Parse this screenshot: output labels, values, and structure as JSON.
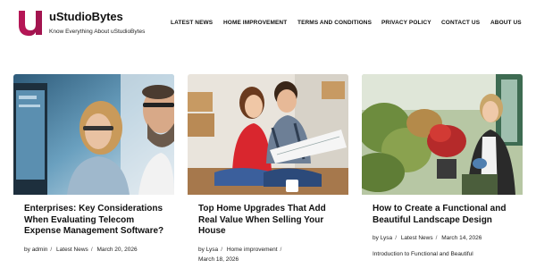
{
  "site": {
    "name": "uStudioBytes",
    "tagline": "Know Everything About uStudioBytes",
    "logo_icon": "u-letter-logo",
    "brand_color": "#a3144f"
  },
  "nav": {
    "items": [
      {
        "label": "LATEST NEWS"
      },
      {
        "label": "HOME IMPROVEMENT"
      },
      {
        "label": "TERMS AND CONDITIONS"
      },
      {
        "label": "PRIVACY POLICY"
      },
      {
        "label": "CONTACT US"
      },
      {
        "label": "ABOUT US"
      }
    ]
  },
  "posts": [
    {
      "title": "Enterprises: Key Considerations When Evaluating Telecom Expense Management Software?",
      "author_prefix": "by",
      "author": "admin",
      "category": "Latest News",
      "date": "March 20, 2026",
      "image": "office-team-monitor-photo"
    },
    {
      "title": "Top Home Upgrades That Add Real Value When Selling Your House",
      "author_prefix": "by",
      "author": "Lysa",
      "category": "Home improvement",
      "date": "March 18, 2026",
      "image": "couple-reviewing-plans-photo"
    },
    {
      "title": "How to Create a Functional and Beautiful Landscape Design",
      "author_prefix": "by",
      "author": "Lysa",
      "category": "Latest News",
      "date": "March 14, 2026",
      "excerpt": "Introduction to Functional and Beautiful",
      "image": "gardener-with-plants-photo"
    }
  ],
  "meta_separator": "/"
}
